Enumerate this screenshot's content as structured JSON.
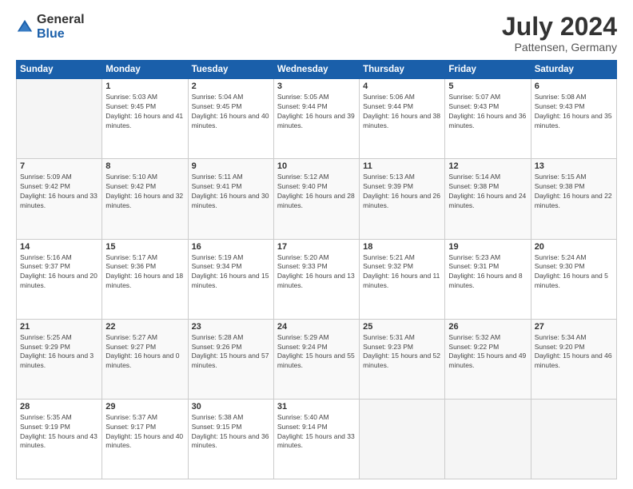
{
  "logo": {
    "general": "General",
    "blue": "Blue"
  },
  "header": {
    "title": "July 2024",
    "subtitle": "Pattensen, Germany"
  },
  "weekdays": [
    "Sunday",
    "Monday",
    "Tuesday",
    "Wednesday",
    "Thursday",
    "Friday",
    "Saturday"
  ],
  "weeks": [
    [
      {
        "day": "",
        "sunrise": "",
        "sunset": "",
        "daylight": ""
      },
      {
        "day": "1",
        "sunrise": "Sunrise: 5:03 AM",
        "sunset": "Sunset: 9:45 PM",
        "daylight": "Daylight: 16 hours and 41 minutes."
      },
      {
        "day": "2",
        "sunrise": "Sunrise: 5:04 AM",
        "sunset": "Sunset: 9:45 PM",
        "daylight": "Daylight: 16 hours and 40 minutes."
      },
      {
        "day": "3",
        "sunrise": "Sunrise: 5:05 AM",
        "sunset": "Sunset: 9:44 PM",
        "daylight": "Daylight: 16 hours and 39 minutes."
      },
      {
        "day": "4",
        "sunrise": "Sunrise: 5:06 AM",
        "sunset": "Sunset: 9:44 PM",
        "daylight": "Daylight: 16 hours and 38 minutes."
      },
      {
        "day": "5",
        "sunrise": "Sunrise: 5:07 AM",
        "sunset": "Sunset: 9:43 PM",
        "daylight": "Daylight: 16 hours and 36 minutes."
      },
      {
        "day": "6",
        "sunrise": "Sunrise: 5:08 AM",
        "sunset": "Sunset: 9:43 PM",
        "daylight": "Daylight: 16 hours and 35 minutes."
      }
    ],
    [
      {
        "day": "7",
        "sunrise": "Sunrise: 5:09 AM",
        "sunset": "Sunset: 9:42 PM",
        "daylight": "Daylight: 16 hours and 33 minutes."
      },
      {
        "day": "8",
        "sunrise": "Sunrise: 5:10 AM",
        "sunset": "Sunset: 9:42 PM",
        "daylight": "Daylight: 16 hours and 32 minutes."
      },
      {
        "day": "9",
        "sunrise": "Sunrise: 5:11 AM",
        "sunset": "Sunset: 9:41 PM",
        "daylight": "Daylight: 16 hours and 30 minutes."
      },
      {
        "day": "10",
        "sunrise": "Sunrise: 5:12 AM",
        "sunset": "Sunset: 9:40 PM",
        "daylight": "Daylight: 16 hours and 28 minutes."
      },
      {
        "day": "11",
        "sunrise": "Sunrise: 5:13 AM",
        "sunset": "Sunset: 9:39 PM",
        "daylight": "Daylight: 16 hours and 26 minutes."
      },
      {
        "day": "12",
        "sunrise": "Sunrise: 5:14 AM",
        "sunset": "Sunset: 9:38 PM",
        "daylight": "Daylight: 16 hours and 24 minutes."
      },
      {
        "day": "13",
        "sunrise": "Sunrise: 5:15 AM",
        "sunset": "Sunset: 9:38 PM",
        "daylight": "Daylight: 16 hours and 22 minutes."
      }
    ],
    [
      {
        "day": "14",
        "sunrise": "Sunrise: 5:16 AM",
        "sunset": "Sunset: 9:37 PM",
        "daylight": "Daylight: 16 hours and 20 minutes."
      },
      {
        "day": "15",
        "sunrise": "Sunrise: 5:17 AM",
        "sunset": "Sunset: 9:36 PM",
        "daylight": "Daylight: 16 hours and 18 minutes."
      },
      {
        "day": "16",
        "sunrise": "Sunrise: 5:19 AM",
        "sunset": "Sunset: 9:34 PM",
        "daylight": "Daylight: 16 hours and 15 minutes."
      },
      {
        "day": "17",
        "sunrise": "Sunrise: 5:20 AM",
        "sunset": "Sunset: 9:33 PM",
        "daylight": "Daylight: 16 hours and 13 minutes."
      },
      {
        "day": "18",
        "sunrise": "Sunrise: 5:21 AM",
        "sunset": "Sunset: 9:32 PM",
        "daylight": "Daylight: 16 hours and 11 minutes."
      },
      {
        "day": "19",
        "sunrise": "Sunrise: 5:23 AM",
        "sunset": "Sunset: 9:31 PM",
        "daylight": "Daylight: 16 hours and 8 minutes."
      },
      {
        "day": "20",
        "sunrise": "Sunrise: 5:24 AM",
        "sunset": "Sunset: 9:30 PM",
        "daylight": "Daylight: 16 hours and 5 minutes."
      }
    ],
    [
      {
        "day": "21",
        "sunrise": "Sunrise: 5:25 AM",
        "sunset": "Sunset: 9:29 PM",
        "daylight": "Daylight: 16 hours and 3 minutes."
      },
      {
        "day": "22",
        "sunrise": "Sunrise: 5:27 AM",
        "sunset": "Sunset: 9:27 PM",
        "daylight": "Daylight: 16 hours and 0 minutes."
      },
      {
        "day": "23",
        "sunrise": "Sunrise: 5:28 AM",
        "sunset": "Sunset: 9:26 PM",
        "daylight": "Daylight: 15 hours and 57 minutes."
      },
      {
        "day": "24",
        "sunrise": "Sunrise: 5:29 AM",
        "sunset": "Sunset: 9:24 PM",
        "daylight": "Daylight: 15 hours and 55 minutes."
      },
      {
        "day": "25",
        "sunrise": "Sunrise: 5:31 AM",
        "sunset": "Sunset: 9:23 PM",
        "daylight": "Daylight: 15 hours and 52 minutes."
      },
      {
        "day": "26",
        "sunrise": "Sunrise: 5:32 AM",
        "sunset": "Sunset: 9:22 PM",
        "daylight": "Daylight: 15 hours and 49 minutes."
      },
      {
        "day": "27",
        "sunrise": "Sunrise: 5:34 AM",
        "sunset": "Sunset: 9:20 PM",
        "daylight": "Daylight: 15 hours and 46 minutes."
      }
    ],
    [
      {
        "day": "28",
        "sunrise": "Sunrise: 5:35 AM",
        "sunset": "Sunset: 9:19 PM",
        "daylight": "Daylight: 15 hours and 43 minutes."
      },
      {
        "day": "29",
        "sunrise": "Sunrise: 5:37 AM",
        "sunset": "Sunset: 9:17 PM",
        "daylight": "Daylight: 15 hours and 40 minutes."
      },
      {
        "day": "30",
        "sunrise": "Sunrise: 5:38 AM",
        "sunset": "Sunset: 9:15 PM",
        "daylight": "Daylight: 15 hours and 36 minutes."
      },
      {
        "day": "31",
        "sunrise": "Sunrise: 5:40 AM",
        "sunset": "Sunset: 9:14 PM",
        "daylight": "Daylight: 15 hours and 33 minutes."
      },
      {
        "day": "",
        "sunrise": "",
        "sunset": "",
        "daylight": ""
      },
      {
        "day": "",
        "sunrise": "",
        "sunset": "",
        "daylight": ""
      },
      {
        "day": "",
        "sunrise": "",
        "sunset": "",
        "daylight": ""
      }
    ]
  ]
}
